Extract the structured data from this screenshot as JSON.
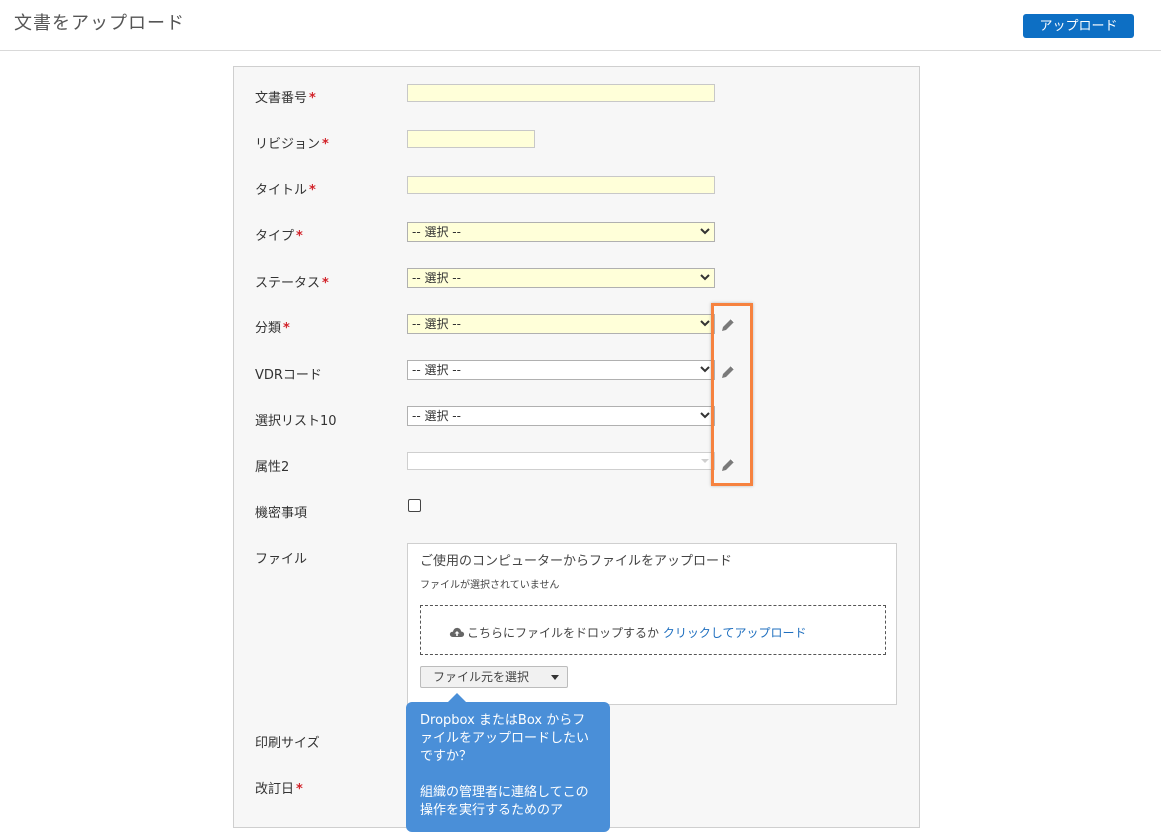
{
  "header": {
    "title": "文書をアップロード",
    "upload_button": "アップロード"
  },
  "form": {
    "required_mark": "*",
    "fields": {
      "doc_number": {
        "label": "文書番号",
        "value": ""
      },
      "revision": {
        "label": "リビジョン",
        "value": ""
      },
      "title": {
        "label": "タイトル",
        "value": ""
      },
      "type": {
        "label": "タイプ",
        "selected": "-- 選択 --"
      },
      "status": {
        "label": "ステータス",
        "selected": "-- 選択 --"
      },
      "category": {
        "label": "分類",
        "selected": "-- 選択 --"
      },
      "vdr_code": {
        "label": "VDRコード",
        "selected": "-- 選択 --"
      },
      "picklist10": {
        "label": "選択リスト10",
        "selected": "-- 選択 --"
      },
      "attribute2": {
        "label": "属性2",
        "selected": ""
      },
      "confidential": {
        "label": "機密事項",
        "checked": false
      },
      "file": {
        "label": "ファイル"
      },
      "print_size": {
        "label": "印刷サイズ"
      },
      "revision_date": {
        "label": "改訂日"
      }
    }
  },
  "file_upload": {
    "heading": "ご使用のコンピューターからファイルをアップロード",
    "status": "ファイルが選択されていません",
    "drop_text": "こちらにファイルをドロップするか",
    "drop_link": "クリックしてアップロード",
    "source_button": "ファイル元を選択"
  },
  "tooltip": {
    "line1": "Dropbox またはBox からファイルをアップロードしたいですか？",
    "line2": "組織の管理者に連絡してこの操作を実行するためのア"
  },
  "colors": {
    "accent": "#0d6fc4",
    "highlight": "#f6823f",
    "required_bg": "#ffffd9",
    "tooltip_bg": "#4a8fd8"
  }
}
